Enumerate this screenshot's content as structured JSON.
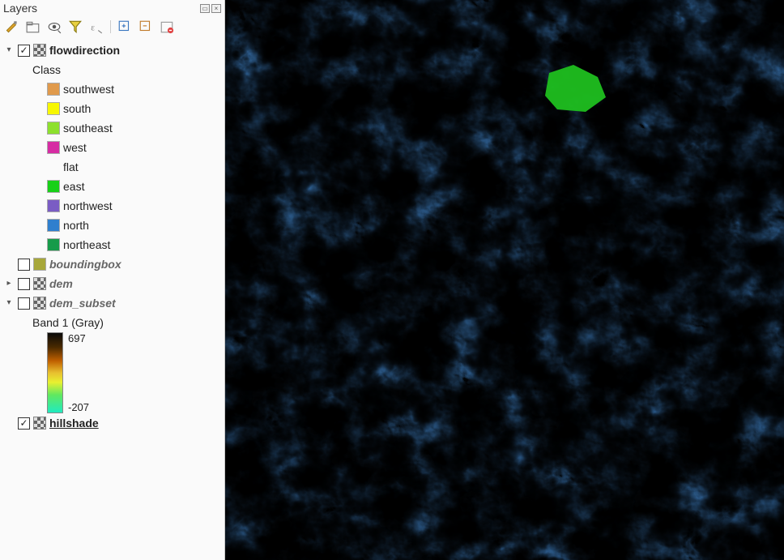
{
  "panel": {
    "title": "Layers"
  },
  "layers": {
    "flowdirection": {
      "name": "flowdirection",
      "legend_title": "Class",
      "classes": [
        {
          "label": "southwest",
          "color": "#e09a4c"
        },
        {
          "label": "south",
          "color": "#f7f700"
        },
        {
          "label": "southeast",
          "color": "#8de02d"
        },
        {
          "label": "west",
          "color": "#d62ca3"
        },
        {
          "label": "flat",
          "color": "transparent"
        },
        {
          "label": "east",
          "color": "#18d018"
        },
        {
          "label": "northwest",
          "color": "#7a5cc4"
        },
        {
          "label": "north",
          "color": "#2f7fce"
        },
        {
          "label": "northeast",
          "color": "#179b4a"
        }
      ]
    },
    "boundingbox": {
      "name": "boundingbox",
      "color": "#a7a73a"
    },
    "dem": {
      "name": "dem"
    },
    "dem_subset": {
      "name": "dem_subset",
      "band_label": "Band 1 (Gray)",
      "max": "697",
      "min": "-207"
    },
    "hillshade": {
      "name": "hillshade"
    }
  }
}
